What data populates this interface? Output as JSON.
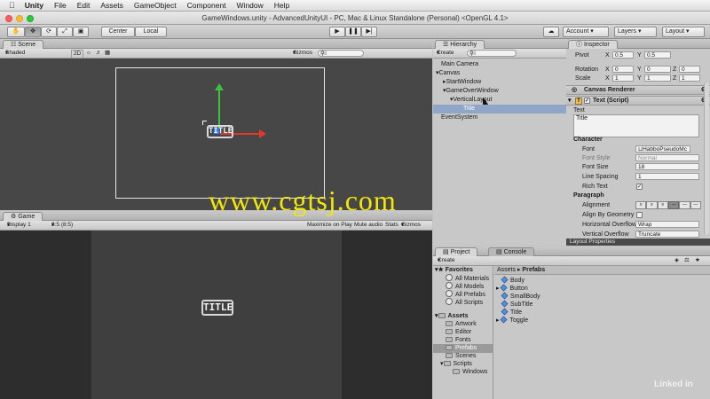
{
  "menubar": {
    "app": "Unity",
    "items": [
      "File",
      "Edit",
      "Assets",
      "GameObject",
      "Component",
      "Window",
      "Help"
    ]
  },
  "window": {
    "title": "GameWindows.unity - AdvancedUnityUI - PC, Mac & Linux Standalone (Personal) <OpenGL 4.1>"
  },
  "toolbar": {
    "pivot_label": "Center",
    "space_label": "Local",
    "account_label": "Account",
    "layers_label": "Layers",
    "layout_label": "Layout"
  },
  "scene": {
    "tab": "Scene",
    "shading": "Shaded",
    "mode_2d": "2D",
    "gizmos": "Gizmos",
    "search_placeholder": "All",
    "object_label": "TITLE"
  },
  "game": {
    "tab": "Game",
    "display": "Display 1",
    "aspect": "8:5 (8:5)",
    "maximize": "Maximize on Play",
    "mute": "Mute audio",
    "stats": "Stats",
    "gizmos": "Gizmos",
    "title_text": "TITLE"
  },
  "hierarchy": {
    "tab": "Hierarchy",
    "create": "Create",
    "search_placeholder": "All",
    "items": [
      {
        "label": "Main Camera"
      },
      {
        "label": "Canvas"
      },
      {
        "label": "StartWindow"
      },
      {
        "label": "GameOverWindow"
      },
      {
        "label": "VerticalLayout"
      },
      {
        "label": "Title"
      },
      {
        "label": "EventSystem"
      }
    ]
  },
  "inspector": {
    "tab": "Inspector",
    "pivot": {
      "label": "Pivot",
      "x": "0.5",
      "y": "0.5"
    },
    "rotation": {
      "label": "Rotation",
      "x": "0",
      "y": "0",
      "z": "0"
    },
    "scale": {
      "label": "Scale",
      "x": "1",
      "y": "1",
      "z": "1"
    },
    "axis_x": "X",
    "axis_y": "Y",
    "axis_z": "Z",
    "canvas_renderer": "Canvas Renderer",
    "text_script": "Text (Script)",
    "text_label": "Text",
    "text_value": "Title",
    "character_header": "Character",
    "font_label": "Font",
    "font_value": "HabboPseudoMc",
    "font_style_label": "Font Style",
    "font_style_value": "Normal",
    "font_size_label": "Font Size",
    "font_size_value": "18",
    "line_spacing_label": "Line Spacing",
    "line_spacing_value": "1",
    "rich_text_label": "Rich Text",
    "paragraph_header": "Paragraph",
    "alignment_label": "Alignment",
    "align_geom_label": "Align By Geometry",
    "h_overflow_label": "Horizontal Overflow",
    "h_overflow_value": "Wrap",
    "v_overflow_label": "Vertical Overflow",
    "v_overflow_value": "Truncate",
    "layout_props": "Layout Properties"
  },
  "project": {
    "tab": "Project",
    "console_tab": "Console",
    "create": "Create",
    "favorites_header": "Favorites",
    "favorites": [
      "All Materials",
      "All Models",
      "All Prefabs",
      "All Scripts"
    ],
    "assets_header": "Assets",
    "folders": [
      "Artwork",
      "Editor",
      "Fonts",
      "Prefabs",
      "Scenes",
      "Scripts",
      "Windows"
    ],
    "breadcrumb_root": "Assets",
    "breadcrumb_leaf": "Prefabs",
    "prefabs": [
      "Body",
      "Button",
      "SmallBody",
      "SubTitle",
      "Title",
      "Toggle"
    ]
  },
  "watermarks": {
    "site": "www.cgtsj.com",
    "brand": "Linked in"
  },
  "colors": {
    "watermark_yellow": "#f2e60a",
    "selection_blue": "#3d6fc4",
    "scene_bg": "#474747",
    "axis_green": "#3ec13e",
    "axis_red": "#e03a2b"
  }
}
